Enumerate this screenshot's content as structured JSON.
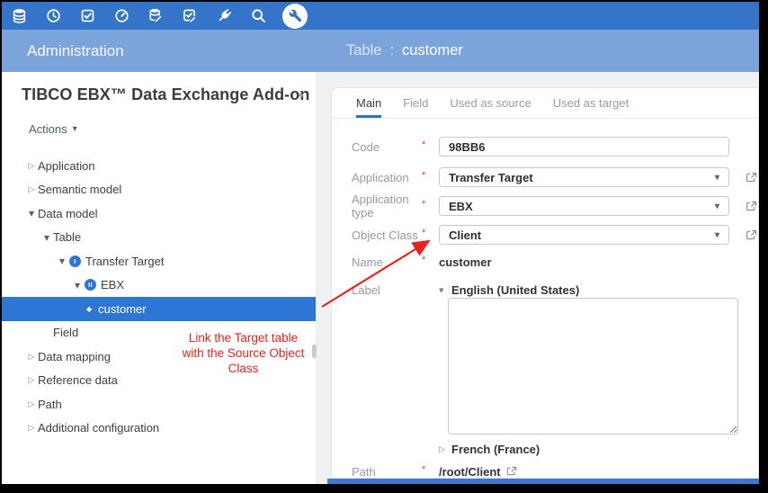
{
  "toolbar": {
    "icons": [
      "database-icon",
      "clock-icon",
      "task-check-icon",
      "gauge-icon",
      "database-edit-icon",
      "checklist-edit-icon",
      "plug-icon",
      "search-icon",
      "wrench-icon"
    ],
    "active_icon": "wrench-icon"
  },
  "header": {
    "left_title": "Administration",
    "entity_label": "Table",
    "separator": ":",
    "entity_name": "customer"
  },
  "sidebar": {
    "title": "TIBCO EBX™ Data Exchange Add-on",
    "actions_label": "Actions",
    "tree": [
      {
        "label": "Application",
        "state": "collapsed",
        "level": 0
      },
      {
        "label": "Semantic model",
        "state": "collapsed",
        "level": 0
      },
      {
        "label": "Data model",
        "state": "expanded",
        "level": 0
      },
      {
        "label": "Table",
        "state": "expanded",
        "level": 1
      },
      {
        "label": "Transfer Target",
        "state": "expanded",
        "level": 2,
        "badge": "I"
      },
      {
        "label": "EBX",
        "state": "expanded",
        "level": 3,
        "badge": "II"
      },
      {
        "label": "customer",
        "state": "leaf",
        "level": 4,
        "selected": true
      },
      {
        "label": "Field",
        "state": "none",
        "level": 1
      },
      {
        "label": "Data mapping",
        "state": "collapsed",
        "level": 0
      },
      {
        "label": "Reference data",
        "state": "collapsed",
        "level": 0
      },
      {
        "label": "Path",
        "state": "collapsed",
        "level": 0
      },
      {
        "label": "Additional configuration",
        "state": "collapsed",
        "level": 0
      }
    ]
  },
  "annotation": {
    "lines": [
      "Link the Target table",
      "with the Source Object",
      "Class"
    ],
    "color": "#e8231d"
  },
  "main": {
    "tabs": [
      {
        "label": "Main",
        "active": true
      },
      {
        "label": "Field",
        "active": false
      },
      {
        "label": "Used as source",
        "active": false
      },
      {
        "label": "Used as target",
        "active": false
      }
    ],
    "form": {
      "code": {
        "label": "Code",
        "required": "*",
        "value": "98BB6"
      },
      "application": {
        "label": "Application",
        "required": "*",
        "value": "Transfer Target"
      },
      "application_type": {
        "label": "Application type",
        "required": "*",
        "value": "EBX"
      },
      "object_class": {
        "label": "Object Class",
        "required": "*",
        "value": "Client"
      },
      "name": {
        "label": "Name",
        "required": "*",
        "value": "customer"
      },
      "label_field": {
        "label": "Label",
        "locales": [
          {
            "name": "English (United States)",
            "state": "expanded",
            "value": ""
          },
          {
            "name": "French (France)",
            "state": "collapsed"
          }
        ]
      },
      "path": {
        "label": "Path",
        "required": "*",
        "value": "/root/Client"
      }
    }
  },
  "colors": {
    "toolbar_blue": "#3474c9",
    "header_blue": "#7ca4da",
    "selection_blue": "#2d76d3",
    "tab_underline": "#2f72c6",
    "annotation_red": "#e8231d"
  }
}
